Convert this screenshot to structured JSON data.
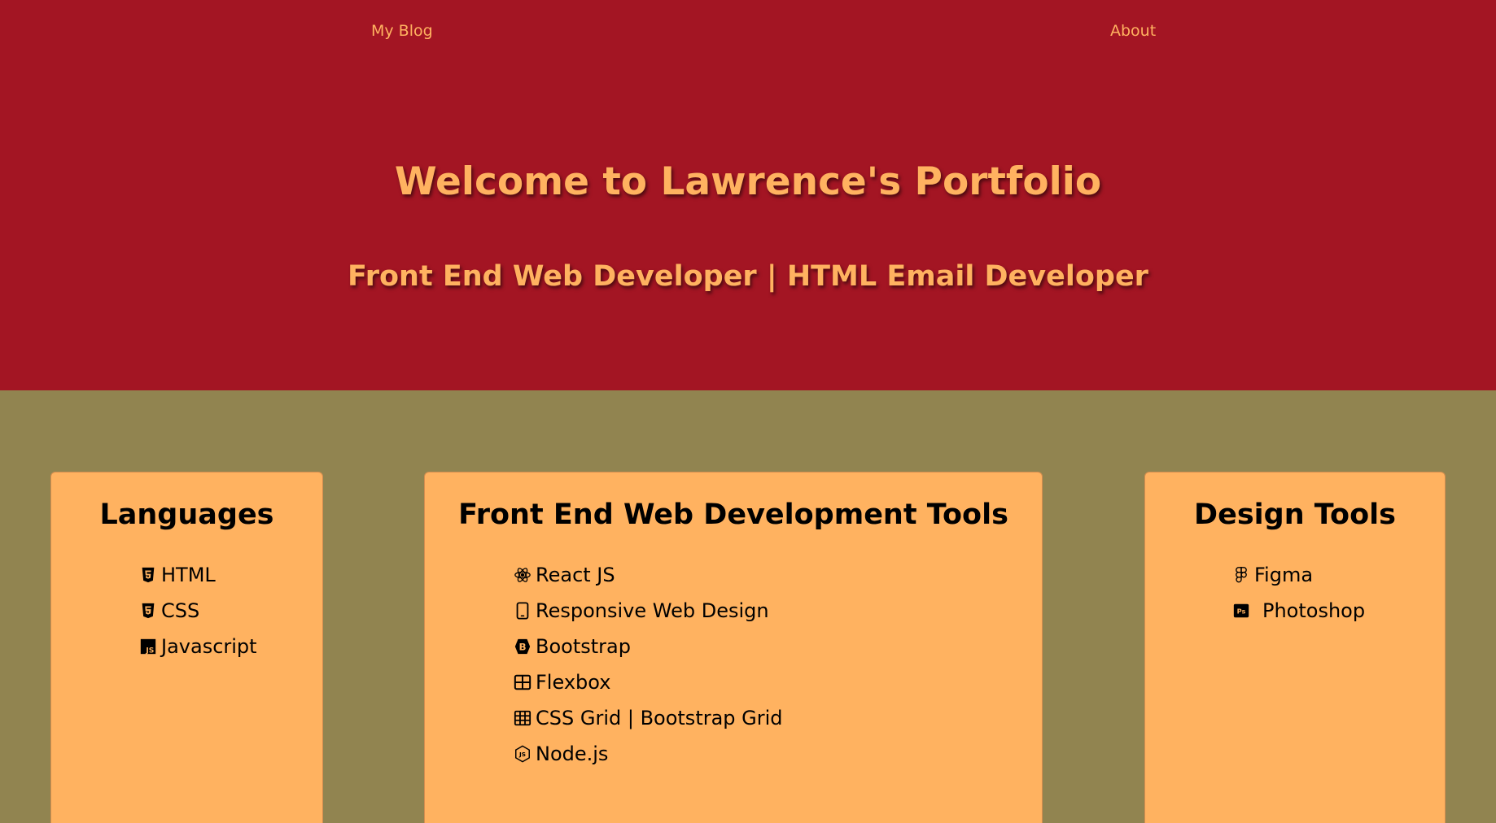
{
  "nav": {
    "blog_label": "My Blog",
    "about_label": "About"
  },
  "hero": {
    "title": "Welcome to Lawrence's Portfolio",
    "subtitle": "Front End Web Developer | HTML Email Developer"
  },
  "cards": {
    "languages": {
      "title": "Languages",
      "items": [
        {
          "label": "HTML",
          "icon": "html5-icon"
        },
        {
          "label": "CSS",
          "icon": "css3-icon"
        },
        {
          "label": "Javascript",
          "icon": "javascript-icon"
        }
      ]
    },
    "frontend": {
      "title": "Front End Web Development Tools",
      "items": [
        {
          "label": "React JS",
          "icon": "react-icon"
        },
        {
          "label": "Responsive Web Design",
          "icon": "mobile-phone-icon"
        },
        {
          "label": "Bootstrap",
          "icon": "bootstrap-icon"
        },
        {
          "label": "Flexbox",
          "icon": "table-grid-icon"
        },
        {
          "label": "CSS Grid | Bootstrap Grid",
          "icon": "table-cells-icon"
        },
        {
          "label": "Node.js",
          "icon": "nodejs-icon"
        }
      ]
    },
    "design": {
      "title": "Design Tools",
      "items": [
        {
          "label": "Figma",
          "icon": "figma-icon"
        },
        {
          "label": "Photoshop",
          "icon": "photoshop-icon"
        }
      ]
    }
  },
  "colors": {
    "hero_bg": "#a31523",
    "accent": "#ffb260",
    "section_bg": "#918450",
    "card_bg": "#ffb260"
  }
}
